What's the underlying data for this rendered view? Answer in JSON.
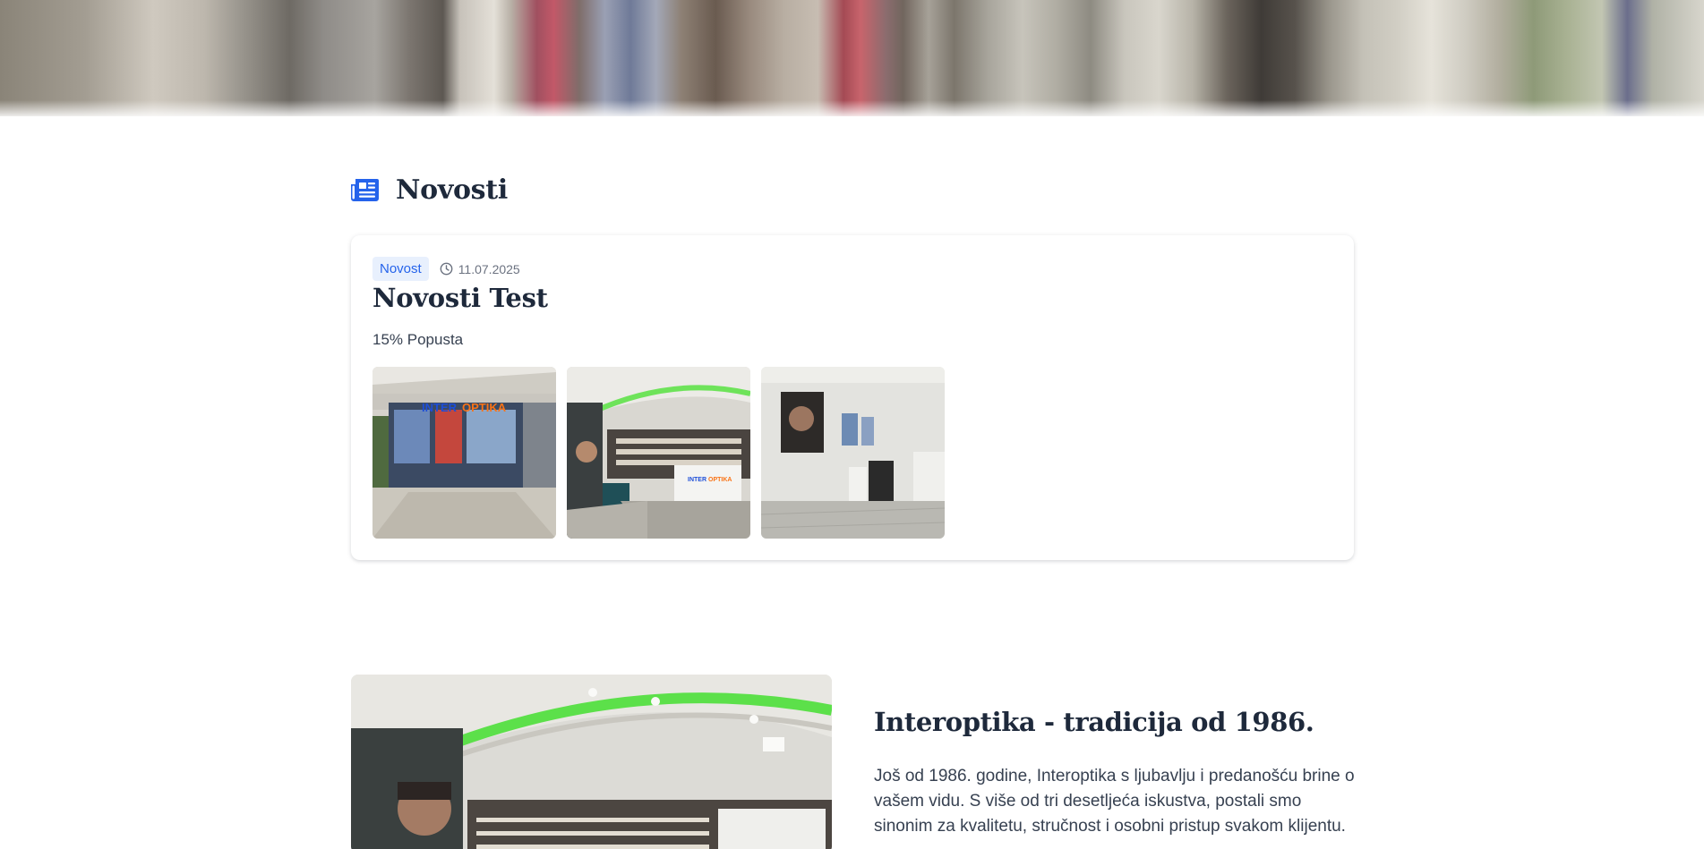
{
  "hero": {
    "image": "blurred-store-interior-photo"
  },
  "news": {
    "heading": "Novosti",
    "icon": "newspaper-icon",
    "accent_color": "#2563eb",
    "items": [
      {
        "badge": "Novost",
        "date": "11.07.2025",
        "title": "Novosti Test",
        "text": "15% Popusta",
        "images": [
          "store-front-photo",
          "store-interior-photo",
          "exam-room-photo"
        ]
      }
    ]
  },
  "about": {
    "title": "Interoptika - tradicija od 1986.",
    "text": "Još od 1986. godine, Interoptika s ljubavlju i predanošću brine o vašem vidu. S više od tri desetljeća iskustva, postali smo sinonim za kvalitetu, stručnost i osobni pristup svakom klijentu.",
    "image": "store-interior-photo"
  },
  "store_sign": {
    "brand_blue": "INTER",
    "brand_orange": "OPTIKA"
  }
}
